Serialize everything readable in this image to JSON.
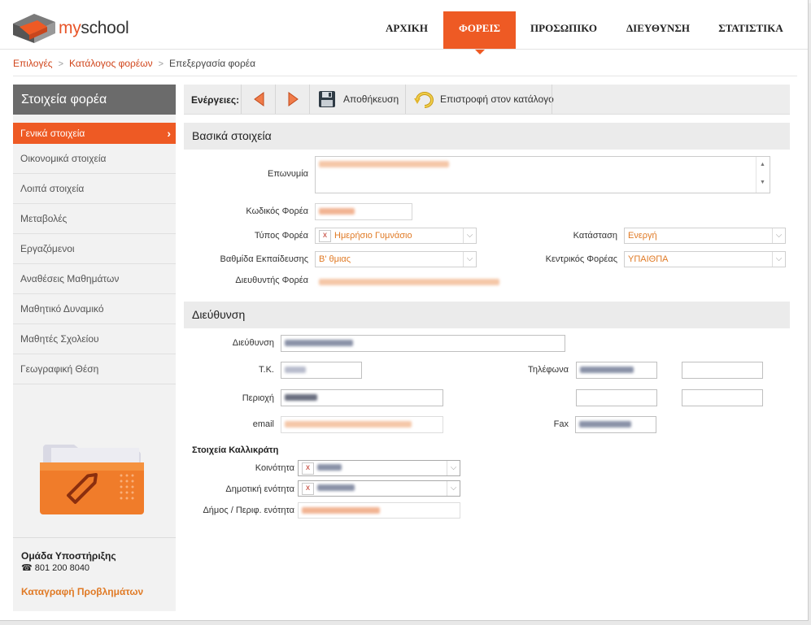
{
  "brand": {
    "prefix": "my",
    "suffix": "school"
  },
  "nav": [
    {
      "label": "ΑΡΧΙΚΗ",
      "active": false
    },
    {
      "label": "ΦΟΡΕΙΣ",
      "active": true
    },
    {
      "label": "ΠΡΟΣΩΠΙΚΟ",
      "active": false
    },
    {
      "label": "ΔΙΕΥΘΥΝΣΗ",
      "active": false
    },
    {
      "label": "ΣΤΑΤΙΣΤΙΚΑ",
      "active": false
    }
  ],
  "breadcrumb": {
    "item1": "Επιλογές",
    "item2": "Κατάλογος φορέων",
    "current": "Επεξεργασία φορέα",
    "separator": ">"
  },
  "sidebar": {
    "title": "Στοιχεία φορέα",
    "items": [
      {
        "label": "Γενικά στοιχεία",
        "active": true
      },
      {
        "label": "Οικονομικά στοιχεία"
      },
      {
        "label": "Λοιπά στοιχεία"
      },
      {
        "label": "Μεταβολές"
      },
      {
        "label": "Εργαζόμενοι"
      },
      {
        "label": "Αναθέσεις Μαθημάτων"
      },
      {
        "label": "Μαθητικό Δυναμικό"
      },
      {
        "label": "Μαθητές Σχολείου"
      },
      {
        "label": "Γεωγραφική Θέση"
      }
    ],
    "support_title": "Ομάδα Υποστήριξης",
    "support_phone": "801 200 8040",
    "support_link": "Καταγραφή Προβλημάτων"
  },
  "toolbar": {
    "label": "Ενέργειες:",
    "save_label": "Αποθήκευση",
    "back_label": "Επιστροφή στον κατάλογο"
  },
  "basic": {
    "heading": "Βασικά στοιχεία",
    "name_label": "Επωνυμία",
    "code_label": "Κωδικός Φορέα",
    "type_label": "Τύπος Φορέα",
    "type_value": "Ημερήσιο Γυμνάσιο",
    "status_label": "Κατάσταση",
    "status_value": "Ενεργή",
    "level_label": "Βαθμίδα Εκπαίδευσης",
    "level_value": "Β' θμιας",
    "central_label": "Κεντρικός Φορέας",
    "central_value": "ΥΠΑΙΘΠΑ",
    "director_label": "Διευθυντής Φορέα"
  },
  "address": {
    "heading": "Διεύθυνση",
    "address_label": "Διεύθυνση",
    "zip_label": "Τ.Κ.",
    "phones_label": "Τηλέφωνα",
    "area_label": "Περιοχή",
    "email_label": "email",
    "fax_label": "Fax"
  },
  "kallikratis": {
    "heading": "Στοιχεία Καλλικράτη",
    "community_label": "Κοινότητα",
    "municipal_unit_label": "Δημοτική ενότητα",
    "municipality_label": "Δήμος / Περιφ. ενότητα"
  },
  "colors": {
    "accent": "#ee5a24",
    "link": "#d0451b",
    "value": "#e07a25",
    "sidebar_header": "#6b6b6b"
  }
}
